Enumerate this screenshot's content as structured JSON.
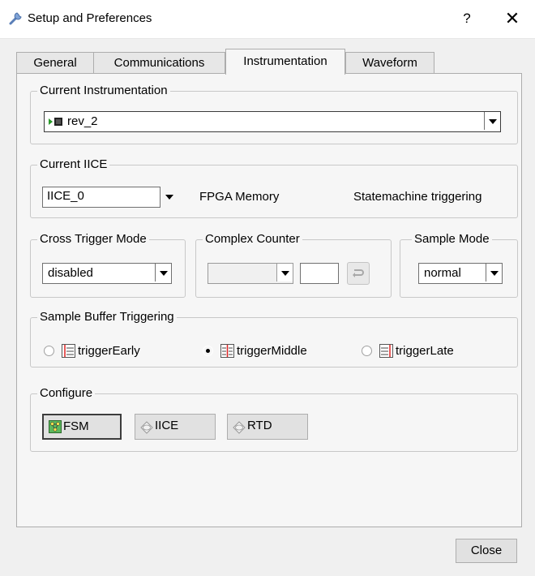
{
  "window": {
    "title": "Setup and Preferences",
    "help_label": "?",
    "close_glyph": "✕",
    "icon": "wrench-icon"
  },
  "tabs": [
    {
      "label": "General",
      "active": false
    },
    {
      "label": "Communications",
      "active": false
    },
    {
      "label": "Instrumentation",
      "active": true
    },
    {
      "label": "Waveform",
      "active": false
    }
  ],
  "current_instrumentation": {
    "title": "Current Instrumentation",
    "selected": "rev_2"
  },
  "current_iice": {
    "title": "Current IICE",
    "selected": "IICE_0",
    "memory_label": "FPGA Memory",
    "trigger_label": "Statemachine triggering"
  },
  "cross_trigger": {
    "title": "Cross Trigger Mode",
    "selected": "disabled"
  },
  "complex_counter": {
    "title": "Complex Counter",
    "selected": "",
    "value": ""
  },
  "sample_mode": {
    "title": "Sample Mode",
    "selected": "normal"
  },
  "sample_buffer": {
    "title": "Sample Buffer Triggering",
    "options": [
      {
        "label": "triggerEarly",
        "checked": false
      },
      {
        "label": "triggerMiddle",
        "checked": true
      },
      {
        "label": "triggerLate",
        "checked": false
      }
    ]
  },
  "configure": {
    "title": "Configure",
    "buttons": [
      {
        "label": "FSM",
        "icon": "fsm-icon"
      },
      {
        "label": "IICE",
        "icon": "iice-icon"
      },
      {
        "label": "RTD",
        "icon": "rtd-icon"
      }
    ]
  },
  "footer": {
    "close_label": "Close"
  }
}
